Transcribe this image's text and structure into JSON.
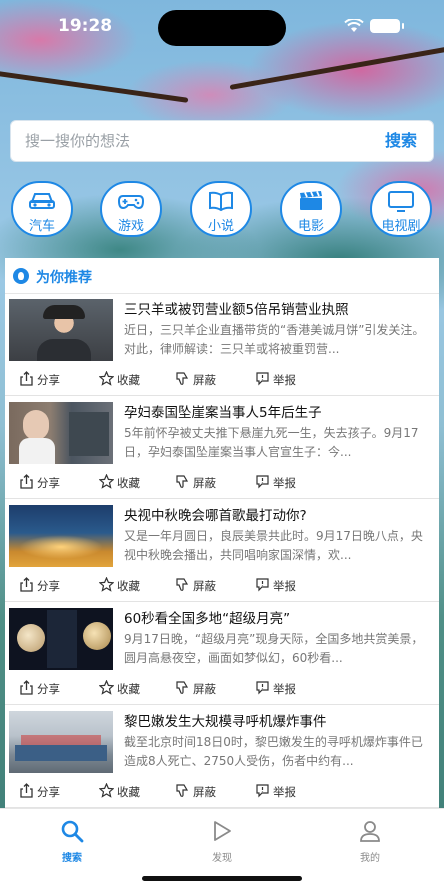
{
  "status_bar": {
    "time": "19:28"
  },
  "search": {
    "placeholder": "搜一搜你的想法",
    "button": "搜索"
  },
  "categories": [
    {
      "label": "汽车",
      "icon": "car-icon"
    },
    {
      "label": "游戏",
      "icon": "gamepad-icon"
    },
    {
      "label": "小说",
      "icon": "book-icon"
    },
    {
      "label": "电影",
      "icon": "clapperboard-icon"
    },
    {
      "label": "电视剧",
      "icon": "tv-icon"
    }
  ],
  "feed": {
    "title": "为你推荐",
    "actions": {
      "share": "分享",
      "favorite": "收藏",
      "block": "屏蔽",
      "report": "举报"
    },
    "items": [
      {
        "title": "三只羊或被罚营业额5倍吊销营业执照",
        "summary": "近日，三只羊企业直播带货的“香港美诚月饼”引发关注。对此，律师解读：三只羊或将被重罚营..."
      },
      {
        "title": "孕妇泰国坠崖案当事人5年后生子",
        "summary": "5年前怀孕被丈夫推下悬崖九死一生，失去孩子。9月17日，孕妇泰国坠崖案当事人官宣生子：今..."
      },
      {
        "title": "央视中秋晚会哪首歌最打动你?",
        "summary": "又是一年月圆日，良辰美景共此时。9月17日晚八点，央视中秋晚会播出，共同唱响家国深情，欢..."
      },
      {
        "title": "60秒看全国多地“超级月亮”",
        "summary": "9月17日晚，“超级月亮”现身天际，全国多地共赏美景，圆月高悬夜空，画面如梦似幻，60秒看..."
      },
      {
        "title": "黎巴嫩发生大规模寻呼机爆炸事件",
        "summary": "截至北京时间18日0时，黎巴嫩发生的寻呼机爆炸事件已造成8人死亡、2750人受伤，伤者中约有..."
      }
    ]
  },
  "tabbar": {
    "tabs": [
      {
        "label": "搜索",
        "icon": "search-icon",
        "active": true
      },
      {
        "label": "发现",
        "icon": "play-icon",
        "active": false
      },
      {
        "label": "我的",
        "icon": "person-icon",
        "active": false
      }
    ]
  },
  "colors": {
    "accent": "#1e88e5"
  }
}
